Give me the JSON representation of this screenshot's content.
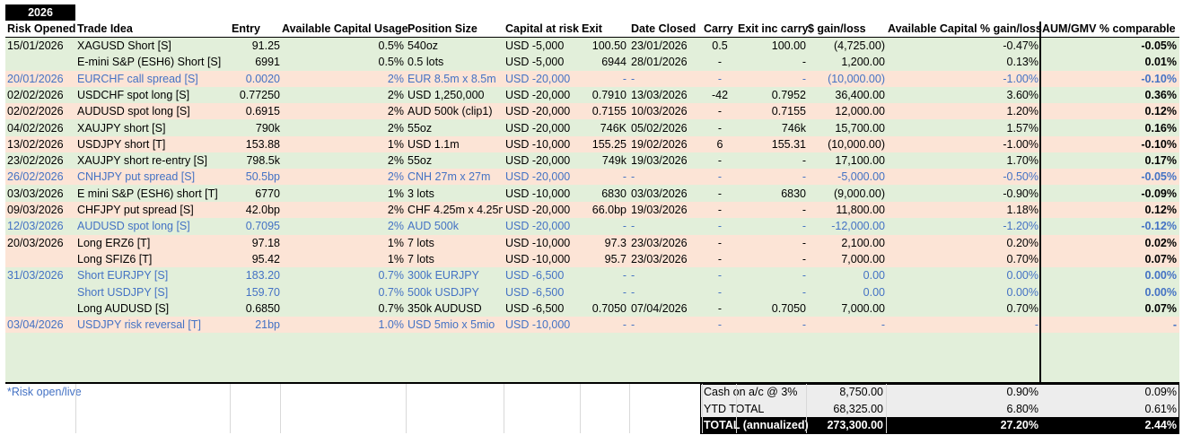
{
  "year": "2026",
  "headers": [
    "Risk Opened",
    "Trade Idea",
    "Entry",
    "Available Capital Usage",
    "Position Size",
    "Capital at risk",
    "Exit",
    "Date Closed",
    "Carry",
    "Exit inc carry",
    "$ gain/loss",
    "Available Capital % gain/loss",
    "AUM/GMV % comparable"
  ],
  "colors": {
    "green": "#e2efda",
    "pink": "#fce4d6",
    "blue": "#4472c4",
    "black": "#000000"
  },
  "rows": [
    {
      "bg": "green",
      "blue": false,
      "c": [
        "15/01/2026",
        "XAGUSD Short [S]",
        "91.25",
        "0.5%",
        "540oz",
        "USD -5,000",
        "100.50",
        "23/01/2026",
        "0.5",
        "100.00",
        "(4,725.00)",
        "-0.47%",
        "-0.05%"
      ]
    },
    {
      "bg": "green",
      "blue": false,
      "c": [
        "",
        "E-mini S&P (ESH6) Short [S]",
        "6991",
        "0.5%",
        "0.5 lots",
        "USD -5,000",
        "6944",
        "28/01/2026",
        "-",
        "-",
        "1,200.00",
        "0.13%",
        "0.01%"
      ]
    },
    {
      "bg": "pink",
      "blue": true,
      "c": [
        "20/01/2026",
        "EURCHF call spread [S]",
        "0.0020",
        "2%",
        "EUR 8.5m x 8.5m",
        "USD -20,000",
        "-",
        "-",
        "-",
        "-",
        "(10,000.00)",
        "-1.00%",
        "-0.10%"
      ]
    },
    {
      "bg": "green",
      "blue": false,
      "c": [
        "02/02/2026",
        "USDCHF spot long [S]",
        "0.77250",
        "2%",
        "USD 1,250,000",
        "USD -20,000",
        "0.7910",
        "13/03/2026",
        "-42",
        "0.7952",
        "36,400.00",
        "3.60%",
        "0.36%"
      ]
    },
    {
      "bg": "pink",
      "blue": false,
      "c": [
        "02/02/2026",
        "AUDUSD spot long [S]",
        "0.6915",
        "2%",
        "AUD 500k (clip1)",
        "USD -20,000",
        "0.7155",
        "10/03/2026",
        "-",
        "0.7155",
        "12,000.00",
        "1.20%",
        "0.12%"
      ]
    },
    {
      "bg": "green",
      "blue": false,
      "c": [
        "04/02/2026",
        "XAUJPY short [S]",
        "790k",
        "2%",
        "55oz",
        "USD -20,000",
        "746K",
        "05/02/2026",
        "-",
        "746k",
        "15,700.00",
        "1.57%",
        "0.16%"
      ]
    },
    {
      "bg": "pink",
      "blue": false,
      "c": [
        "13/02/2026",
        "USDJPY short [T]",
        "153.88",
        "1%",
        "USD 1.1m",
        "USD -10,000",
        "155.25",
        "19/02/2026",
        "6",
        "155.31",
        "(10,000.00)",
        "-1.00%",
        "-0.10%"
      ]
    },
    {
      "bg": "green",
      "blue": false,
      "c": [
        "23/02/2026",
        "XAUJPY short re-entry [S]",
        "798.5k",
        "2%",
        "55oz",
        "USD -20,000",
        "749k",
        "19/03/2026",
        "-",
        "-",
        "17,100.00",
        "1.70%",
        "0.17%"
      ]
    },
    {
      "bg": "pink",
      "blue": true,
      "c": [
        "26/02/2026",
        "CNHJPY put spread [S]",
        "50.5bp",
        "2%",
        "CNH 27m x 27m",
        "USD -20,000",
        "-",
        "-",
        "-",
        "-",
        "-5,000.00",
        "-0.50%",
        "-0.05%"
      ]
    },
    {
      "bg": "green",
      "blue": false,
      "c": [
        "03/03/2026",
        "E mini S&P (ESH6) short [T]",
        "6770",
        "1%",
        "3 lots",
        "USD -10,000",
        "6830",
        "03/03/2026",
        "-",
        "6830",
        "(9,000.00)",
        "-0.90%",
        "-0.09%"
      ]
    },
    {
      "bg": "pink",
      "blue": false,
      "c": [
        "09/03/2026",
        "CHFJPY put spread [S]",
        "42.0bp",
        "2%",
        "CHF 4.25m x 4.25m",
        "USD -20,000",
        "66.0bp",
        "19/03/2026",
        "-",
        "-",
        "11,800.00",
        "1.18%",
        "0.12%"
      ]
    },
    {
      "bg": "green",
      "blue": true,
      "c": [
        "12/03/2026",
        "AUDUSD spot long [S]",
        "0.7095",
        "2%",
        "AUD 500k",
        "USD -20,000",
        "-",
        "-",
        "-",
        "-",
        "-12,000.00",
        "-1.20%",
        "-0.12%"
      ]
    },
    {
      "bg": "pink",
      "blue": false,
      "c": [
        "20/03/2026",
        "Long ERZ6 [T]",
        "97.18",
        "1%",
        "7 lots",
        "USD -10,000",
        "97.3",
        "23/03/2026",
        "-",
        "-",
        "2,100.00",
        "0.20%",
        "0.02%"
      ]
    },
    {
      "bg": "pink",
      "blue": false,
      "c": [
        "",
        "Long SFIZ6 [T]",
        "95.42",
        "1%",
        "7 lots",
        "USD -10,000",
        "95.7",
        "23/03/2026",
        "-",
        "-",
        "7,000.00",
        "0.70%",
        "0.07%"
      ]
    },
    {
      "bg": "green",
      "blue": true,
      "c": [
        "31/03/2026",
        "Short EURJPY [S]",
        "183.20",
        "0.7%",
        "300k EURJPY",
        "USD -6,500",
        "-",
        "-",
        "-",
        "-",
        "0.00",
        "0.00%",
        "0.00%"
      ]
    },
    {
      "bg": "green",
      "blue": true,
      "c": [
        "",
        "Short USDJPY [S]",
        "159.70",
        "0.7%",
        "500k USDJPY",
        "USD -6,500",
        "-",
        "-",
        "-",
        "-",
        "0.00",
        "0.00%",
        "0.00%"
      ]
    },
    {
      "bg": "green",
      "blue": false,
      "c": [
        "",
        "Long AUDUSD [S]",
        "0.6850",
        "0.7%",
        "350k AUDUSD",
        "USD -6,500",
        "0.7050",
        "07/04/2026",
        "-",
        "0.7050",
        "7,000.00",
        "0.70%",
        "0.07%"
      ]
    },
    {
      "bg": "pink",
      "blue": true,
      "c": [
        "03/04/2026",
        "USDJPY risk reversal [T]",
        "21bp",
        "1.0%",
        "USD 5mio x 5mio",
        "USD -10,000",
        "-",
        "-",
        "-",
        "-",
        "-",
        "-",
        "-"
      ]
    }
  ],
  "footnote": "*Risk open/live",
  "summary": [
    {
      "label": "Cash on a/c @ 3%",
      "value": "8,750.00",
      "pct": "0.90%",
      "aum": "0.09%"
    },
    {
      "label": "YTD TOTAL",
      "value": "68,325.00",
      "pct": "6.80%",
      "aum": "0.61%"
    },
    {
      "label": "TOTAL (annualized)",
      "value": "273,300.00",
      "pct": "27.20%",
      "aum": "2.44%"
    }
  ]
}
